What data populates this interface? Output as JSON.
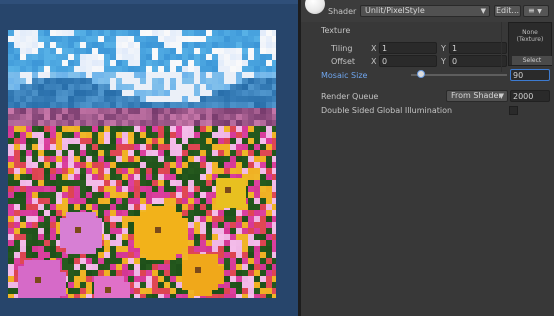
{
  "colors": {
    "scene_bg": "#27456b",
    "inspector_bg": "#383838",
    "accent": "#4c8fe8",
    "field_bg": "#2a2a2a"
  },
  "viewport": {
    "image": "pixelated-flower-field",
    "mosaic": "pixel-style"
  },
  "inspector": {
    "shader_label": "Shader",
    "shader_value": "Unlit/PixelStyle",
    "edit_button": "Edit...",
    "list_icon": "≡",
    "texture_label": "Texture",
    "tiling_label": "Tiling",
    "offset_label": "Offset",
    "tiling": {
      "x_label": "X",
      "x": "1",
      "y_label": "Y",
      "y": "1"
    },
    "offset": {
      "x_label": "X",
      "x": "0",
      "y_label": "Y",
      "y": "0"
    },
    "texture_slot": {
      "line1": "None",
      "line2": "(Texture)",
      "select": "Select"
    },
    "mosaic_label": "Mosaic Size",
    "mosaic_value": "90",
    "mosaic_fraction": 0.1,
    "render_queue_label": "Render Queue",
    "render_queue_mode": "From Shader",
    "render_queue_value": "2000",
    "dsgi_label": "Double Sided Global Illumination",
    "dsgi_checked": false
  }
}
